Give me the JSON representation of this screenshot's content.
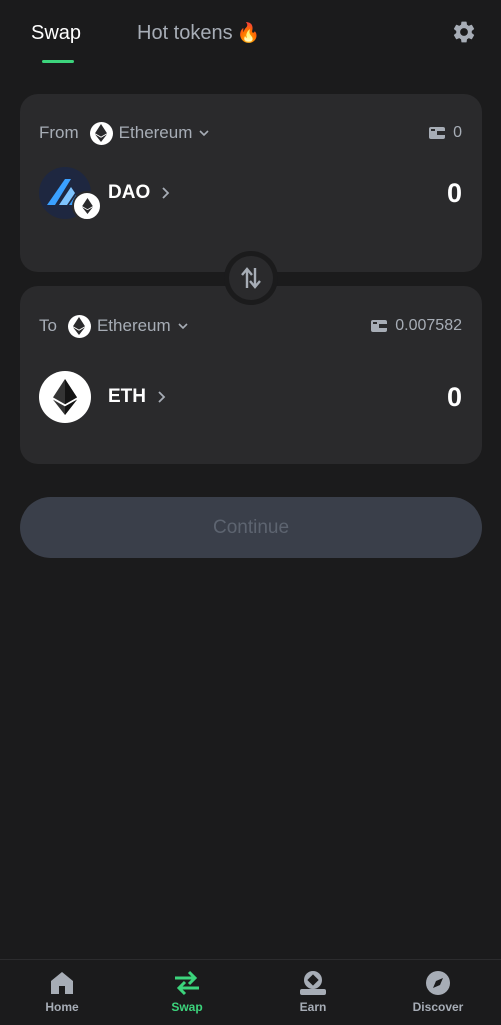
{
  "tabs": {
    "swap": "Swap",
    "hot_tokens": "Hot tokens",
    "hot_tokens_emoji": "🔥"
  },
  "from": {
    "label": "From",
    "chain": "Ethereum",
    "balance": "0",
    "token": "DAO",
    "amount": "0"
  },
  "to": {
    "label": "To",
    "chain": "Ethereum",
    "balance": "0.007582",
    "token": "ETH",
    "amount": "0"
  },
  "continue_label": "Continue",
  "nav": {
    "home": "Home",
    "swap": "Swap",
    "earn": "Earn",
    "discover": "Discover"
  },
  "colors": {
    "accent": "#3cd47c",
    "background": "#1b1b1c",
    "card": "#2a2a2c",
    "muted_text": "#a7adb6",
    "button_disabled": "#3a3f4a"
  },
  "icons": [
    "settings-gear-icon",
    "ethereum-icon",
    "chevron-down-icon",
    "wallet-icon",
    "chevron-right-icon",
    "swap-direction-icon",
    "home-icon",
    "swap-arrows-icon",
    "earn-icon",
    "compass-icon",
    "flame-icon"
  ]
}
